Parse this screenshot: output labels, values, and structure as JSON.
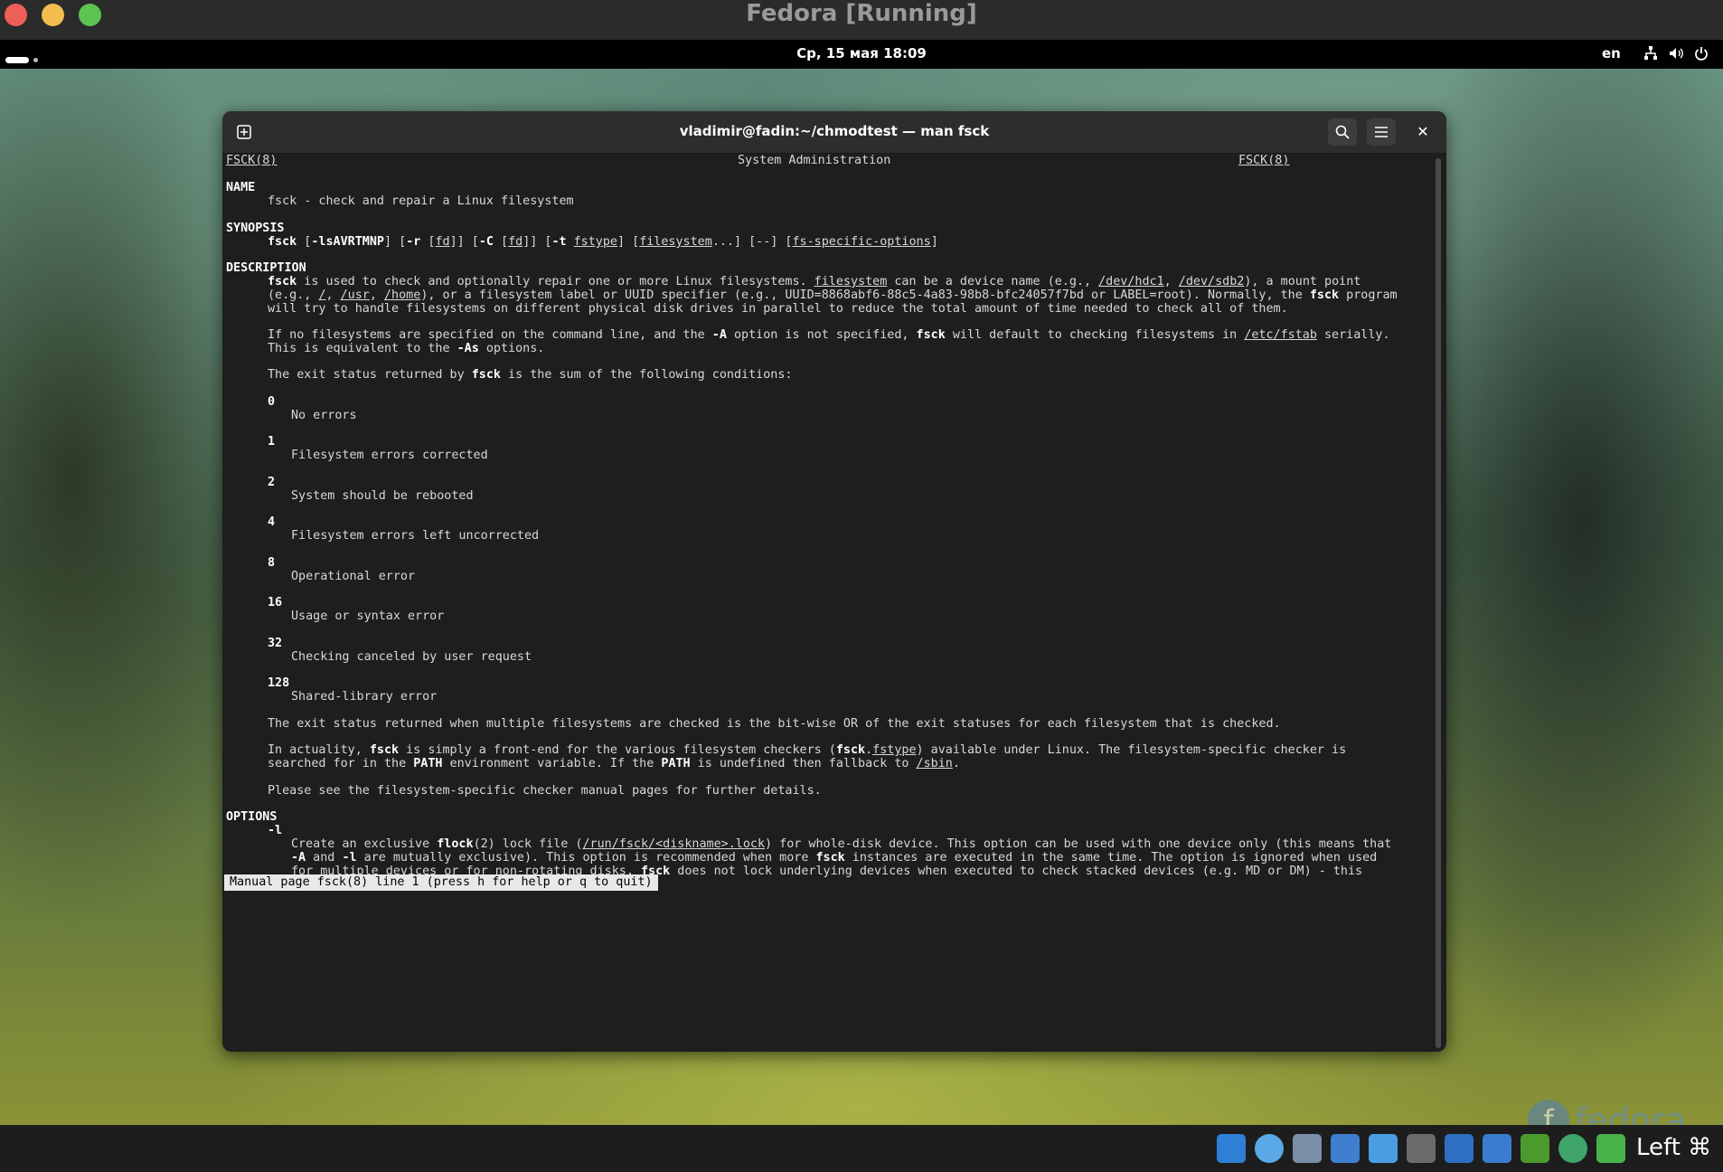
{
  "vm_window": {
    "title": "Fedora [Running]"
  },
  "gnome_bar": {
    "clock": "Ср, 15 мая  18:09",
    "lang": "en"
  },
  "terminal": {
    "title": "vladimir@fadin:~/chmodtest — man fsck",
    "status_line": "Manual page fsck(8) line 1 (press h for help or q to quit)"
  },
  "man": {
    "header_left": "FSCK(8)",
    "header_center": "System Administration",
    "header_right": "FSCK(8)",
    "name_h": "NAME",
    "name_line": "fsck - check and repair a Linux filesystem",
    "synopsis_h": "SYNOPSIS",
    "description_h": "DESCRIPTION",
    "options_h": "OPTIONS",
    "opt_l": "-l",
    "exit_intro": "The exit status returned by fsck is the sum of the following conditions:",
    "exit_codes": [
      {
        "code": "0",
        "desc": "No errors"
      },
      {
        "code": "1",
        "desc": "Filesystem errors corrected"
      },
      {
        "code": "2",
        "desc": "System should be rebooted"
      },
      {
        "code": "4",
        "desc": "Filesystem errors left uncorrected"
      },
      {
        "code": "8",
        "desc": "Operational error"
      },
      {
        "code": "16",
        "desc": "Usage or syntax error"
      },
      {
        "code": "32",
        "desc": "Checking canceled by user request"
      },
      {
        "code": "128",
        "desc": "Shared-library error"
      }
    ],
    "bitwise": "The exit status returned when multiple filesystems are checked is the bit-wise OR of the exit statuses for each filesystem that is checked.",
    "see_also": "Please see the filesystem-specific checker manual pages for further details."
  },
  "taskbar": {
    "hostkey": "Left ⌘"
  },
  "branding": {
    "fedora_word": "fedora"
  }
}
